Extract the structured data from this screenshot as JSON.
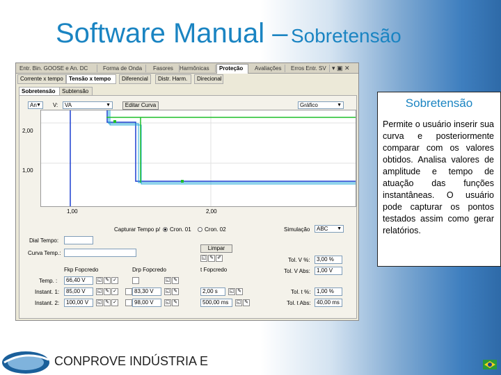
{
  "slide": {
    "title_main": "Software Manual –",
    "title_sub": "Sobretensão",
    "footer": "CONPROVE INDÚSTRIA E"
  },
  "window": {
    "tabs": [
      "Entr. Bin. GOOSE e An. DC",
      "Forma de Onda",
      "Fasores",
      "Harmônicas",
      "Proteção",
      "Avaliações",
      "Erros Entr. SV"
    ],
    "active_tab": "Proteção",
    "ctrl": "▾ ▣ ✕",
    "subtabs": [
      "Corrente x tempo",
      "Tensão x tempo",
      "Diferencial",
      "Distr. Harm.",
      "Direcional"
    ],
    "active_subtab": "Tensão x tempo",
    "subsubtabs": [
      "Sobretensão",
      "Subtensão"
    ],
    "active_subsubtab": "Sobretensão"
  },
  "plot_controls": {
    "select1": "An",
    "v_label": "V:",
    "select2": "VA",
    "edit_curve_label": "Editar Curva",
    "graph_type": "Gráfico"
  },
  "chart_data": {
    "type": "line",
    "x_ticks": [
      "1,00",
      "2,00"
    ],
    "y_ticks": [
      "2,00",
      "1,00"
    ]
  },
  "capture": {
    "label": "Capturar Tempo p/",
    "cron1": "Cron. 01",
    "cron2": "Cron. 02",
    "sim_label": "Simulação",
    "sim_value": "ABC"
  },
  "dial": {
    "label": "Dial Tempo:",
    "value": ""
  },
  "curve": {
    "label": "Curva Temp.:",
    "clear_button": "Limpar"
  },
  "tolerances": {
    "tol_v_pct_label": "Tol. V %:",
    "tol_v_pct": "3,00 %",
    "tol_v_abs_label": "Tol. V Abs:",
    "tol_v_abs": "1,00 V",
    "tol_t_pct_label": "Tol. t %:",
    "tol_t_pct": "1,00 %",
    "tol_t_abs_label": "Tol. t Abs:",
    "tol_t_abs": "40,00 ms"
  },
  "table": {
    "headers": [
      "Fkp Fopcredo",
      "Drp Fopcredo",
      "t Fopcredo"
    ],
    "rows": [
      {
        "label": "Temp. :",
        "pickup": "66,40 V",
        "dropout": "",
        "time": ""
      },
      {
        "label": "Instant. 1:",
        "pickup": "85,00 V",
        "dropout": "83,30 V",
        "time": "2,00 s"
      },
      {
        "label": "Instant. 2:",
        "pickup": "100,00 V",
        "dropout": "98,00 V",
        "time": "500,00 ms"
      }
    ]
  },
  "info_box": {
    "title": "Sobretensão",
    "text": "Permite o usuário inserir sua curva e posteriormente comparar com os valores obtidos. Analisa valores de amplitude e tempo de atuação das funções instantâneas. O usuário pode capturar os pontos testados assim como gerar relatórios."
  },
  "colors": {
    "title": "#1a84c2",
    "curve_green": "#1fbf2a",
    "curve_blue": "#1a3fd0",
    "curve_cyan": "#20a8d8"
  }
}
